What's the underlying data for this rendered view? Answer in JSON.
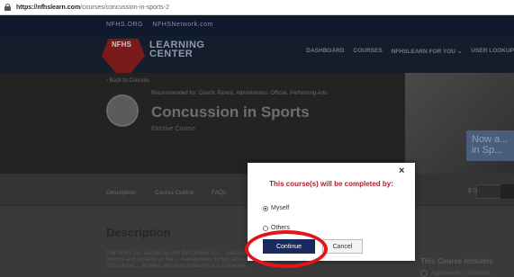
{
  "browser": {
    "url_host": "https://nfhslearn.com",
    "url_path": "/courses/concussion-in-sports-2"
  },
  "site": {
    "top_links": [
      "NFHS.ORG",
      "NFHSNetwork.com"
    ],
    "logo_text": "NFHS",
    "brand_line1": "LEARNING",
    "brand_line2": "CENTER",
    "nav": [
      "DASHBOARD",
      "COURSES",
      "NFHSLEARN FOR YOU ⌄",
      "USER LOOKUP"
    ]
  },
  "course": {
    "back_link": "‹ Back to Courses",
    "recommended": "Recommended for: Coach, Parent, Administrator, Official, Performing Arts",
    "title": "Concussion in Sports",
    "type": "Elective Course",
    "badge": "Now a... in Sp..."
  },
  "tabs": [
    "Description",
    "Course Outline",
    "FAQs"
  ],
  "price": "$ 0",
  "description": {
    "heading": "Description",
    "text": "The NFHS has teamed up with the Centers for ... coaches, officials, parents and students on the ... management in high school sports. This course ... athletes, and how to recognize a suspected ..."
  },
  "includes": {
    "heading": "This Course Includes",
    "item": "Approved for 1 Clock Ho..."
  },
  "modal": {
    "title": "This course(s) will be completed by:",
    "options": [
      "Myself",
      "Others"
    ],
    "selected": "Myself",
    "continue_label": "Continue",
    "cancel_label": "Cancel",
    "close_glyph": "×"
  },
  "colors": {
    "modal_title": "#b11d2a",
    "continue_bg": "#1b2a5e",
    "highlight_ring": "#e4141b"
  }
}
